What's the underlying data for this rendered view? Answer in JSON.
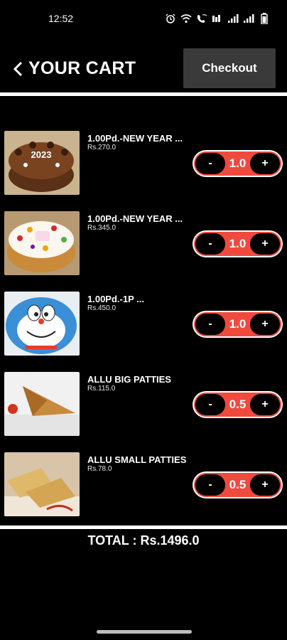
{
  "status": {
    "time": "12:52",
    "icons": [
      "alarm-icon",
      "wifi-icon",
      "wifi-call-icon",
      "volte-icon",
      "signal-icon",
      "signal-icon",
      "battery-icon"
    ]
  },
  "header": {
    "title": "YOUR CART",
    "checkout_label": "Checkout"
  },
  "cart": {
    "items": [
      {
        "name": "1.00Pd.-NEW YEAR ...",
        "price": "Rs.270.0",
        "quantity": "1.0",
        "minus": "-",
        "plus": "+"
      },
      {
        "name": "1.00Pd.-NEW YEAR ...",
        "price": "Rs.345.0",
        "quantity": "1.0",
        "minus": "-",
        "plus": "+"
      },
      {
        "name": "1.00Pd.-1P ...",
        "price": "Rs.450.0",
        "quantity": "1.0",
        "minus": "-",
        "plus": "+"
      },
      {
        "name": "ALLU BIG PATTIES",
        "price": "Rs.115.0",
        "quantity": "0.5",
        "minus": "-",
        "plus": "+"
      },
      {
        "name": "ALLU SMALL PATTIES",
        "price": "Rs.78.0",
        "quantity": "0.5",
        "minus": "-",
        "plus": "+"
      }
    ]
  },
  "total": "TOTAL : Rs.1496.0",
  "colors": {
    "accent": "#f04a3e",
    "checkout_bg": "#3a3a3a",
    "background": "#000000"
  }
}
